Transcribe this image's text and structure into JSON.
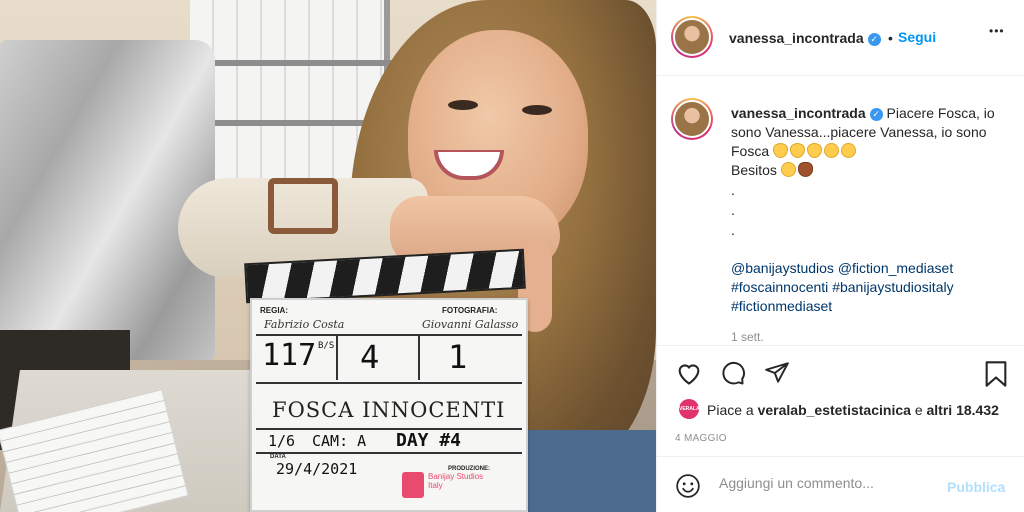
{
  "post": {
    "photo_alt": "",
    "clapperboard": {
      "regia_label": "REGIA:",
      "fotografia_label": "FOTOGRAFIA:",
      "director": "Fabrizio Costa",
      "photographer": "Giovanni Galasso",
      "scene": "117",
      "scene_suffix": "B/S",
      "shot": "4",
      "take": "1",
      "title": "FOSCA INNOCENTI",
      "episode": "1/6",
      "cam": "CAM: A",
      "day": "DAY #4",
      "data_label": "DATA",
      "date": "29/4/2021",
      "produzione_label": "PRODUZIONE:",
      "producer": "Banijay Studios Italy"
    }
  },
  "header": {
    "username": "vanessa_incontrada",
    "separator": "•",
    "follow_label": "Segui",
    "more_label": "•••"
  },
  "caption": {
    "username": "vanessa_incontrada",
    "line1": "Piacere Fosca, io sono Vanessa...piacere Vanessa, io sono Fosca",
    "line2": "Besitos",
    "dots": [
      ".",
      ".",
      "."
    ],
    "hashtags": [
      "@banijaystudios",
      "@fiction_mediaset",
      "#foscainnocenti",
      "#banijaystudiositaly",
      "#fictionmediaset"
    ],
    "time": "1 sett."
  },
  "likes": {
    "avatar_label": "VERALAB",
    "prefix": "Piace a",
    "liker": "veralab_estetistacinica",
    "middle": "e",
    "others": "altri 18.432"
  },
  "date": "4 MAGGIO",
  "comment": {
    "placeholder": "Aggiungi un commento...",
    "publish_label": "Pubblica"
  },
  "icons": {
    "like": "heart-icon",
    "comment": "comment-icon",
    "share": "share-icon",
    "save": "bookmark-icon",
    "emoji": "emoji-icon",
    "verified": "verified-icon"
  },
  "colors": {
    "accent": "#0095f6",
    "verified": "#3897f0",
    "publish_disabled": "#b2dffc",
    "secondary_text": "#8e8e8e"
  }
}
